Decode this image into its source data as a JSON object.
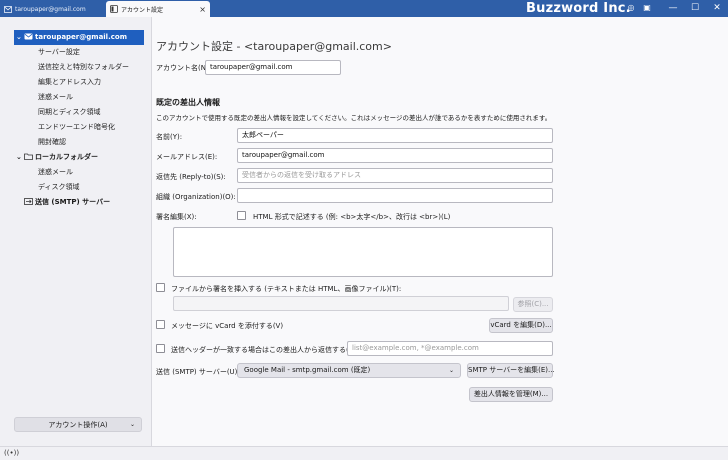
{
  "titlebar": {
    "tab_inactive_label": "taroupaper@gmail.com",
    "tab_active_label": "アカウント設定",
    "brand": "Buzzword Inc.",
    "accent_color": "#2f5fa8"
  },
  "sidebar": {
    "account": "taroupaper@gmail.com",
    "account_subitems": [
      "サーバー設定",
      "送信控えと特別なフォルダー",
      "編集とアドレス入力",
      "迷惑メール",
      "同期とディスク領域",
      "エンドツーエンド暗号化",
      "開封確認"
    ],
    "local_folder": "ローカルフォルダー",
    "local_subitems": [
      "迷惑メール",
      "ディスク領域"
    ],
    "smtp": "送信 (SMTP) サーバー",
    "account_actions": "アカウント操作(A)"
  },
  "main": {
    "title": "アカウント設定 - <taroupaper@gmail.com>",
    "account_name_label": "アカウント名(N):",
    "account_name_value": "taroupaper@gmail.com",
    "identity_heading": "既定の差出人情報",
    "identity_desc": "このアカウントで使用する既定の差出人情報を設定してください。これはメッセージの差出人が誰であるかを表すために使用されます。",
    "name_label": "名前(Y):",
    "name_value": "太郎ペーパー",
    "email_label": "メールアドレス(E):",
    "email_value": "taroupaper@gmail.com",
    "replyto_label": "返信先 (Reply-to)(S):",
    "replyto_placeholder": "受信者からの返信を受け取るアドレス",
    "org_label": "組織 (Organization)(O):",
    "org_value": "",
    "sig_label": "署名編集(X):",
    "sig_html_label": "HTML 形式で記述する (例: <b>太字</b>、改行は <br>)(L)",
    "sig_file_label": "ファイルから署名を挿入する (テキストまたは HTML、画像ファイル)(T):",
    "browse_label": "参照(C)...",
    "vcard_label": "メッセージに vCard を添付する(V)",
    "vcard_edit_label": "vCard を編集(D)...",
    "reply_header_label": "送信ヘッダーが一致する場合はこの差出人から返信する(B):",
    "reply_header_placeholder": "list@example.com, *@example.com",
    "smtp_label": "送信 (SMTP) サーバー(U):",
    "smtp_value": "Google Mail - smtp.gmail.com (既定)",
    "smtp_edit_label": "SMTP サーバーを編集(E)...",
    "manage_identities_label": "差出人情報を管理(M)..."
  }
}
